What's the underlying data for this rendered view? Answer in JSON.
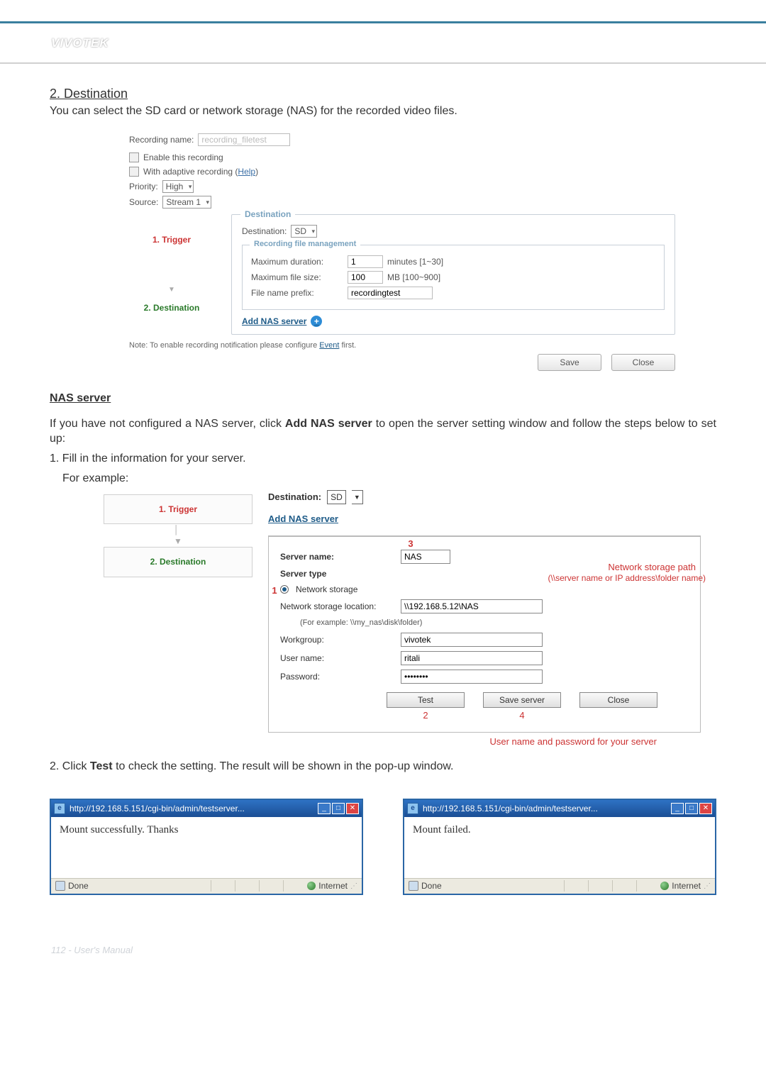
{
  "brand": "VIVOTEK",
  "section": {
    "heading": "2. Destination",
    "intro": "You can select the SD card or network storage (NAS) for the recorded video files."
  },
  "shot1": {
    "recording_name_label": "Recording name:",
    "recording_name_placeholder": "recording_filetest",
    "cb_enable": "Enable this recording",
    "cb_adaptive_prefix": "With adaptive recording (",
    "cb_adaptive_help": "Help",
    "cb_adaptive_suffix": ")",
    "priority_label": "Priority:",
    "priority_value": "High",
    "source_label": "Source:",
    "source_value": "Stream 1",
    "steps": {
      "trigger": "1. Trigger",
      "destination": "2. Destination"
    },
    "dest_legend": "Destination",
    "dest_label": "Destination:",
    "dest_value": "SD",
    "fm_legend": "Recording file management",
    "max_dur_label": "Maximum duration:",
    "max_dur_value": "1",
    "max_dur_hint": "minutes [1~30]",
    "max_size_label": "Maximum file size:",
    "max_size_value": "100",
    "max_size_hint": "MB [100~900]",
    "prefix_label": "File name prefix:",
    "prefix_value": "recordingtest",
    "add_nas": "Add NAS server",
    "note_prefix": "Note: To enable recording notification please configure ",
    "note_link": "Event",
    "note_suffix": " first.",
    "btn_save": "Save",
    "btn_close": "Close"
  },
  "nas_section": {
    "heading": "NAS server",
    "p1_a": "If you have not configured a NAS server, click ",
    "p1_b": "Add NAS server",
    "p1_c": " to open the server setting window and follow the steps below to set up:",
    "li1": "1. Fill in the information for your server.",
    "li1b": "For example:"
  },
  "shot2": {
    "step1": "1. Trigger",
    "step2": "2. Destination",
    "dest_label": "Destination:",
    "dest_value": "SD",
    "add_nas": "Add NAS server",
    "server_name_label": "Server name:",
    "server_name_value": "NAS",
    "server_type_label": "Server type",
    "radio_ns": "Network storage",
    "ns_loc_label": "Network storage location:",
    "ns_loc_value": "\\\\192.168.5.12\\NAS",
    "ns_hint": "(For example: \\\\my_nas\\disk\\folder)",
    "wg_label": "Workgroup:",
    "wg_value": "vivotek",
    "user_label": "User name:",
    "user_value": "ritali",
    "pw_label": "Password:",
    "pw_value": "••••••••",
    "btn_test": "Test",
    "btn_save": "Save server",
    "btn_close": "Close",
    "call_path_a": "Network storage path",
    "call_path_b": "(\\\\server name or IP address\\folder name)",
    "call_creds": "User name and password for your server",
    "c1": "1",
    "c2": "2",
    "c3": "3",
    "c4": "4"
  },
  "teststep": {
    "line_a": "2. Click ",
    "line_b": "Test",
    "line_c": " to check the setting. The result will be shown in the pop-up window."
  },
  "popups": {
    "title": "http://192.168.5.151/cgi-bin/admin/testserver...",
    "ok_msg": "Mount successfully. Thanks",
    "fail_msg": "Mount failed.",
    "done": "Done",
    "zone": "Internet"
  },
  "footer": "112 - User's Manual"
}
